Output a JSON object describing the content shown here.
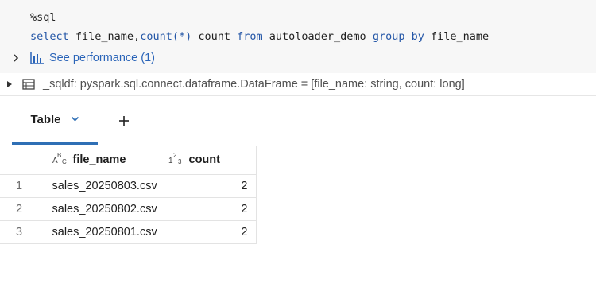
{
  "code": {
    "magic": "%sql",
    "tokens": [
      {
        "text": "select",
        "kw": true
      },
      {
        "text": " file_name,",
        "kw": false
      },
      {
        "text": "count",
        "kw": true
      },
      {
        "text": "(*)",
        "kw": true
      },
      {
        "text": " count ",
        "kw": false
      },
      {
        "text": "from",
        "kw": true
      },
      {
        "text": " autoloader_demo ",
        "kw": false
      },
      {
        "text": "group by",
        "kw": true
      },
      {
        "text": " file_name",
        "kw": false
      }
    ]
  },
  "performance": {
    "label": "See performance (1)"
  },
  "dataframe": {
    "text": "_sqldf:  pyspark.sql.connect.dataframe.DataFrame = [file_name: string, count: long]"
  },
  "tabs": {
    "active_label": "Table"
  },
  "table": {
    "columns": [
      {
        "type_icon": "ABC",
        "label": "file_name"
      },
      {
        "type_icon": "123",
        "label": "count"
      }
    ],
    "rows": [
      {
        "index": "1",
        "file_name": "sales_20250803.csv",
        "count": "2"
      },
      {
        "index": "2",
        "file_name": "sales_20250802.csv",
        "count": "2"
      },
      {
        "index": "3",
        "file_name": "sales_20250801.csv",
        "count": "2"
      }
    ]
  },
  "colors": {
    "keyword": "#2557a7",
    "link": "#2a64b8",
    "tab_underline": "#2f6fb5",
    "source_bg": "#f7f7f7"
  }
}
